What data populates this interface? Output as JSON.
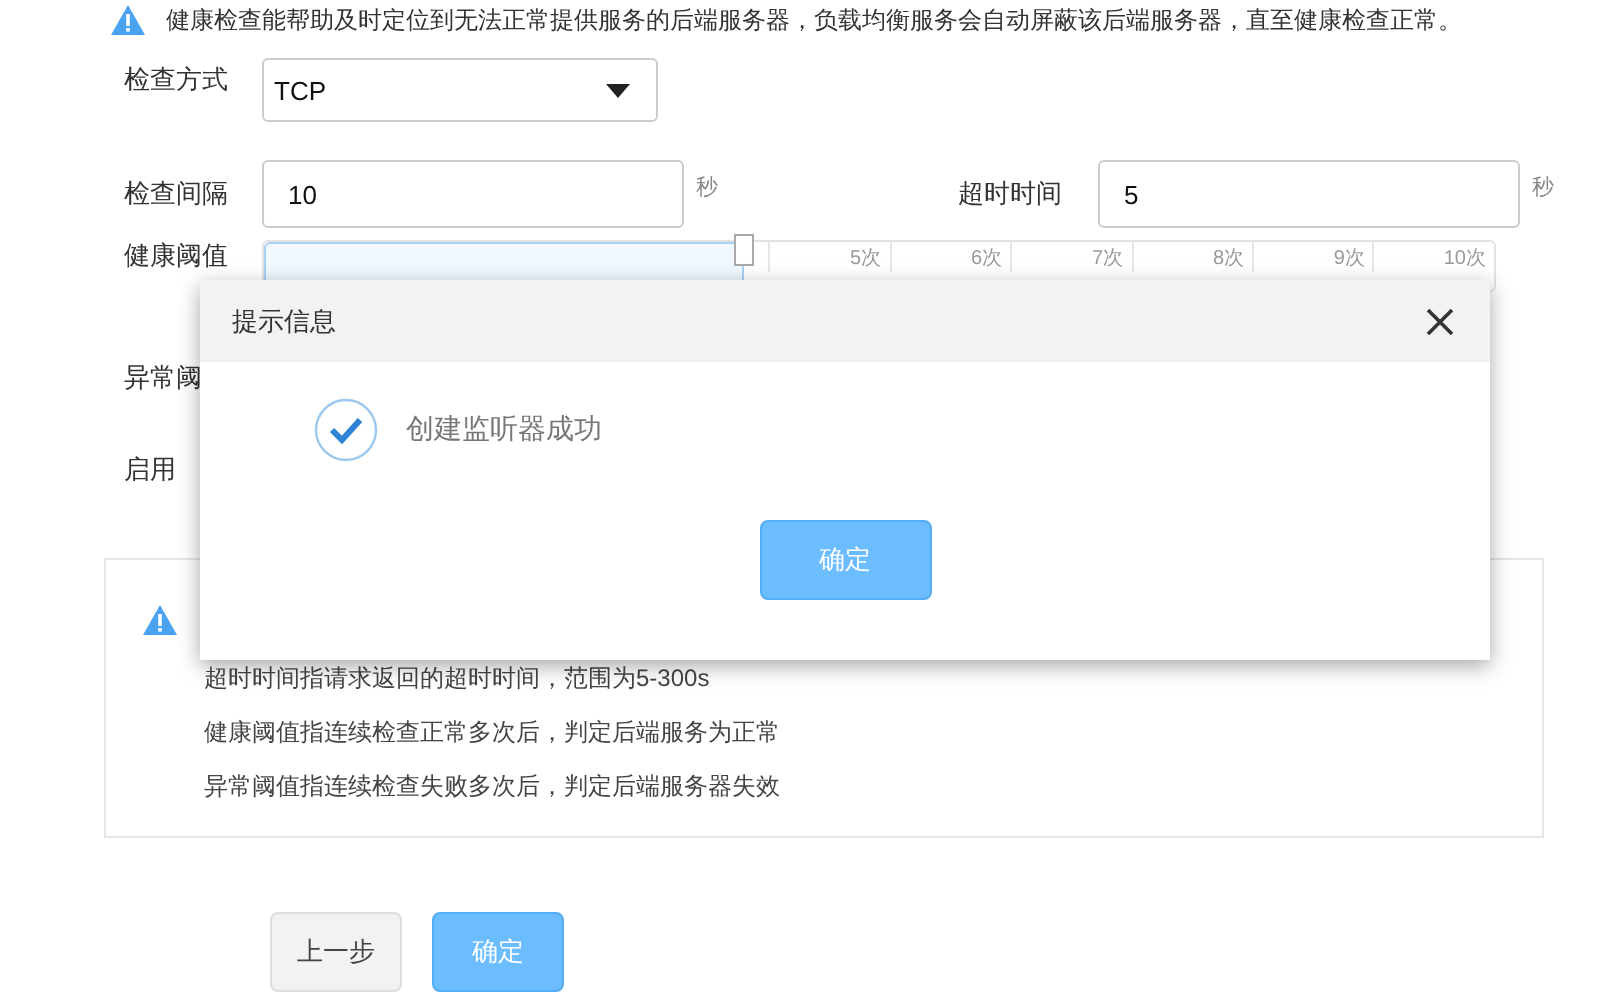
{
  "notice": {
    "text": "健康检查能帮助及时定位到无法正常提供服务的后端服务器，负载均衡服务会自动屏蔽该后端服务器，直至健康检查正常。"
  },
  "form": {
    "check_method": {
      "label": "检查方式",
      "value": "TCP"
    },
    "interval": {
      "label": "检查间隔",
      "value": "10",
      "unit": "秒"
    },
    "timeout": {
      "label": "超时时间",
      "value": "5",
      "unit": "秒"
    },
    "healthy_threshold": {
      "label": "健康阈值",
      "level": 0.39,
      "ticks": [
        "5次",
        "6次",
        "7次",
        "8次",
        "9次",
        "10次"
      ]
    },
    "unhealthy_threshold": {
      "label": "异常阈"
    },
    "enable": {
      "label": "启用"
    }
  },
  "tips": {
    "lines": [
      "超时时间指请求返回的超时时间，范围为5-300s",
      "健康阈值指连续检查正常多次后，判定后端服务为正常",
      "异常阈值指连续检查失败多次后，判定后端服务器失效"
    ]
  },
  "buttons": [
    {
      "label": "上一步",
      "kind": "secondary"
    },
    {
      "label": "确定",
      "kind": "primary"
    }
  ],
  "dialog": {
    "title": "提示信息",
    "message": "创建监听器成功",
    "button": "确定"
  }
}
